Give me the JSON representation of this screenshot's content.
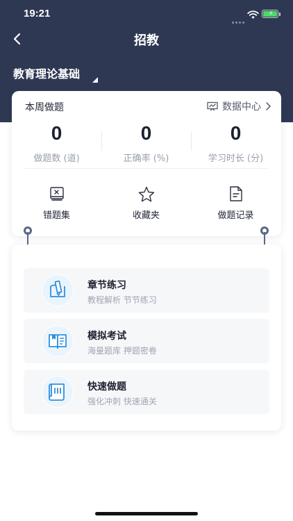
{
  "status": {
    "time": "19:21"
  },
  "nav": {
    "title": "招教"
  },
  "subject": {
    "name": "教育理论基础"
  },
  "weekly": {
    "label": "本周做题",
    "data_center_label": "数据中心",
    "stats": [
      {
        "value": "0",
        "label": "做题数 (道)"
      },
      {
        "value": "0",
        "label": "正确率 (%)"
      },
      {
        "value": "0",
        "label": "学习时长 (分)"
      }
    ],
    "tools": [
      {
        "label": "错题集",
        "icon": "wrong-book-icon"
      },
      {
        "label": "收藏夹",
        "icon": "star-icon"
      },
      {
        "label": "做题记录",
        "icon": "record-icon"
      }
    ]
  },
  "practice": [
    {
      "title": "章节练习",
      "subtitle": "教程解析 节节练习",
      "icon": "chapter-icon"
    },
    {
      "title": "模拟考试",
      "subtitle": "海量题库 押题密卷",
      "icon": "exam-book-icon"
    },
    {
      "title": "快速做题",
      "subtitle": "强化冲刺 快速通关",
      "icon": "scroll-icon"
    }
  ],
  "colors": {
    "header": "#2f3853",
    "accent": "#2d8fe0",
    "battery": "#4cd964"
  }
}
